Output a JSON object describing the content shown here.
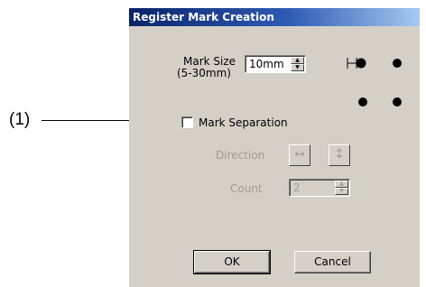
{
  "annotation": {
    "label": "(1)"
  },
  "dialog": {
    "title": "Register Mark Creation",
    "mark_size": {
      "label_line1": "Mark Size",
      "label_line2": "(5-30mm)",
      "value": "10mm"
    },
    "mark_separation": {
      "label": "Mark Separation",
      "checked": false
    },
    "direction": {
      "label": "Direction",
      "horizontal_symbol": "↔",
      "vertical_symbol": "↕"
    },
    "count": {
      "label": "Count",
      "value": "2"
    },
    "buttons": {
      "ok": "OK",
      "cancel": "Cancel"
    }
  }
}
